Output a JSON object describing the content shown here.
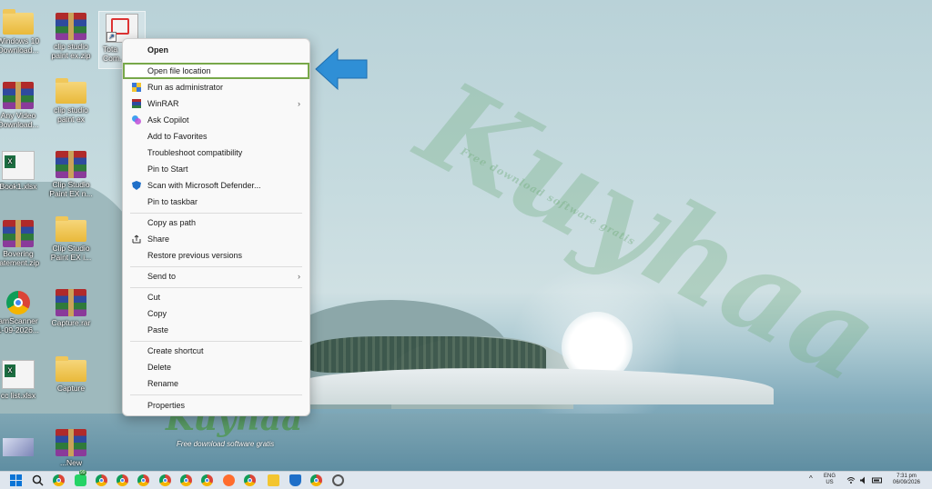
{
  "desktop": {
    "icons": [
      {
        "label": "Windows 10\nDownload...",
        "type": "folder"
      },
      {
        "label": "clip studio\npaint ex.zip",
        "type": "winrar"
      },
      {
        "label": "Tota\nCom...",
        "type": "pdfapp"
      },
      {
        "label": "Any Video\nDownload...",
        "type": "winrar"
      },
      {
        "label": "clip studio\npaint ex",
        "type": "folder"
      },
      {
        "label": "Book1.xlsx",
        "type": "excel"
      },
      {
        "label": "Clip Studio\nPaint EX n...",
        "type": "winrar"
      },
      {
        "label": "Bovering\ntatement.zip",
        "type": "winrar"
      },
      {
        "label": "Clip Studio\nPaint EX i...",
        "type": "folder"
      },
      {
        "label": "amScanner\n1-09-2026...",
        "type": "chrome"
      },
      {
        "label": "Capture.rar",
        "type": "winrar"
      },
      {
        "label": "cc list.xlsx",
        "type": "excel"
      },
      {
        "label": "Capture",
        "type": "folder"
      },
      {
        "label": "...New",
        "type": "winrar"
      }
    ]
  },
  "context_menu": {
    "items": {
      "open": "Open",
      "open_file_location": "Open file location",
      "run_as_admin": "Run as administrator",
      "winrar": "WinRAR",
      "ask_copilot": "Ask Copilot",
      "add_favorites": "Add to Favorites",
      "troubleshoot": "Troubleshoot compatibility",
      "pin_start": "Pin to Start",
      "scan_defender": "Scan with Microsoft Defender...",
      "pin_taskbar": "Pin to taskbar",
      "copy_path": "Copy as path",
      "share": "Share",
      "restore_versions": "Restore previous versions",
      "send_to": "Send to",
      "cut": "Cut",
      "copy": "Copy",
      "paste": "Paste",
      "create_shortcut": "Create shortcut",
      "delete": "Delete",
      "rename": "Rename",
      "properties": "Properties"
    },
    "submenu_chevron": "›"
  },
  "watermark": {
    "text": "Kuyhaa",
    "subtext": "Free download software gratis"
  },
  "taskbar": {
    "badge": "99",
    "tray": {
      "language": "ENG",
      "region": "US",
      "time": "7:31 pm",
      "date": "06/09/2026"
    }
  },
  "colors": {
    "highlight_border": "#78a84a",
    "arrow": "#2f8fd6"
  }
}
